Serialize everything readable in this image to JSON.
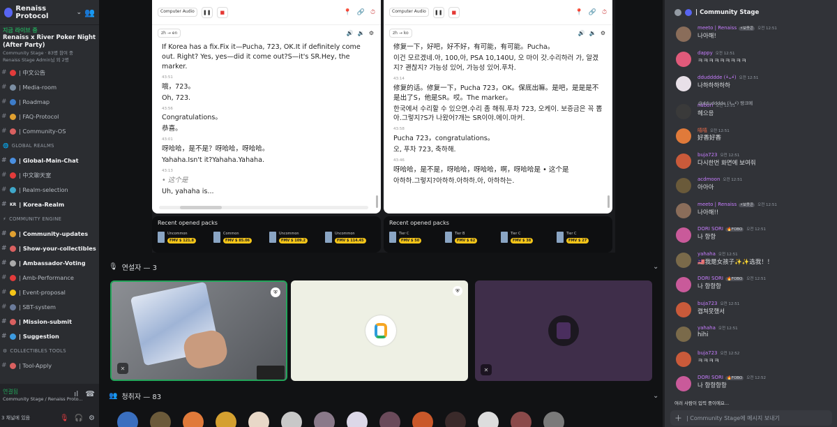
{
  "sidebar": {
    "server_name": "Renaiss Protocol",
    "live_tag": "지금 라이브 중",
    "event_title": "Renaiss x River Poker Night (After Party)",
    "stage_line": "Community Stage · 83명 참여 중",
    "admin_line": "Renaiss Stage Admin님 외 2명",
    "channels_top": [
      {
        "label": "| 中文公告",
        "color": "#e23b3b"
      },
      {
        "label": "| Media-room",
        "color": "#7b8ea3"
      },
      {
        "label": "| Roadmap",
        "color": "#3d7cc9"
      },
      {
        "label": "| FAQ-Protocol",
        "color": "#e0a030"
      },
      {
        "label": "| Community-OS",
        "color": "#d96060"
      }
    ],
    "cat_global": "GLOBAL REALMS",
    "channels_global": [
      {
        "label": "| Global-Main-Chat",
        "color": "#4a8fe0",
        "bold": true
      },
      {
        "label": "| 中文聊天室",
        "color": "#e23b3b"
      },
      {
        "label": "| Realm-selection",
        "color": "#3fa7c9"
      },
      {
        "label": "| Korea-Realm",
        "prefix": "KR",
        "bold": true
      }
    ],
    "cat_engine": "COMMUNITY ENGINE",
    "channels_engine": [
      {
        "label": "| Community-updates",
        "color": "#e0a030",
        "bold": true
      },
      {
        "label": "| Show-your-collectibles",
        "color": "#d96060",
        "bold": true
      },
      {
        "label": "| Ambassador-Voting",
        "color": "#aaa",
        "bold": true
      },
      {
        "label": "| Amb-Performance",
        "color": "#e23b3b"
      },
      {
        "label": "| Event-proposal",
        "color": "#f5c518"
      },
      {
        "label": "| SBT-system",
        "color": "#6b7b9b"
      },
      {
        "label": "| Mission-submit",
        "color": "#d96060",
        "bold": true
      },
      {
        "label": "| Suggestion",
        "color": "#3d9be0",
        "bold": true
      }
    ],
    "cat_tools": "COLLECTIBLES TOOLS",
    "channels_tools": [
      {
        "label": "| Tool-Apply",
        "color": "#d96060"
      }
    ],
    "voice_status": "연결됨",
    "voice_location": "Community Stage / Renaiss Proto...",
    "user_line": "3 채널에 있음"
  },
  "screenshare": {
    "left": {
      "source": "Computer Audio",
      "lang": "zh → en",
      "lines": [
        {
          "t": "",
          "text": "If Korea has a fix.Fix it—Pucha, 723, OK.It if definitely come out. Right? Yes, yes—did it come out?S—it's SR.Hey, the marker."
        },
        {
          "t": "43:51",
          "text": "哦，723。"
        },
        {
          "t": "",
          "text": "Oh, 723."
        },
        {
          "t": "43:56",
          "text": "Congratulations。"
        },
        {
          "t": "",
          "text": "恭喜。"
        },
        {
          "t": "43:01",
          "text": "呀哈哈，是不是？呀哈哈，呀哈哈。"
        },
        {
          "t": "",
          "text": "Yahaha.Isn't it?Yahaha.Yahaha."
        },
        {
          "t": "43:13",
          "text": "• 这个是",
          "pending": true
        },
        {
          "t": "",
          "text": "Uh, yahaha is..."
        }
      ],
      "packs_title": "Recent opened packs",
      "packs": [
        {
          "name": "Uncommon",
          "fmv": "FMV $ 121.8"
        },
        {
          "name": "Common",
          "fmv": "FMV $ 85.06"
        },
        {
          "name": "Uncommon",
          "fmv": "FMV $ 109.2"
        },
        {
          "name": "Uncommon",
          "fmv": "FMV $ 114.45"
        }
      ]
    },
    "right": {
      "source": "Computer Audio",
      "lang": "zh → ko",
      "lines": [
        {
          "t": "",
          "text": "修复一下，好吧，好不好，有可能，有可能。Pucha。"
        },
        {
          "t": "",
          "text": "이건 모르겠네.아, 100,아, PSA 10,140U, 오 마이 갓.수리하러 가, 알겠지? 괜찮지? 가능성 있어, 가능성 있어.푸차."
        },
        {
          "t": "43:14",
          "text": "修复的话。修复一下，Pucha 723，OK。保底出嘛。是吧，是是是不是出了S，他是SR。哎。The marker。"
        },
        {
          "t": "",
          "text": "한국에서 수리할 수 있으면.수리 좀 해줘.푸차 723, 오케이. 보증금은 꼭 뽑아.그렇지?S가 나왔어?개는 SR이야.에이.마커."
        },
        {
          "t": "43:58",
          "text": "Pucha 723，congratulations。"
        },
        {
          "t": "",
          "text": "오, 푸차 723, 축하해."
        },
        {
          "t": "43:46",
          "text": "呀哈哈，是不是，呀哈哈，呀哈哈，啊，呀哈哈是 • 这个是"
        },
        {
          "t": "",
          "text": "아하하.그렇지?아하하.아하하.아, 아하하는."
        }
      ],
      "packs_title": "Recent opened packs",
      "packs": [
        {
          "name": "Tier C",
          "fmv": "FMV $ 50"
        },
        {
          "name": "Tier B",
          "fmv": "FMV $ 62"
        },
        {
          "name": "Tier C",
          "fmv": "FMV $ 38"
        },
        {
          "name": "Tier C",
          "fmv": "FMV $ 27"
        }
      ]
    }
  },
  "stage": {
    "speakers_label": "연설자 — 3",
    "audience_label": "청취자 — 83"
  },
  "chat": {
    "header": "| Community Stage",
    "input_placeholder": "| Community Stage에 메시지 보내기",
    "typing": "여러 사람이 입력 중이에요...",
    "reply_preview": "@ddudddde (•̀ᴗ•́)  땅크메",
    "messages": [
      {
        "name": "meeto | Renaiss",
        "badge": "⚡보좃콘",
        "time": "오전 12:51",
        "body": "나아해!",
        "color": "#c77dff",
        "av": "#8a6d5a"
      },
      {
        "name": "dappy",
        "time": "오전 12:51",
        "body": "ㅋㅋㅋㅋㅋㅋㅋㅋㅋ",
        "color": "#c77dff",
        "av": "#e05a7a"
      },
      {
        "name": "ddudddde (•̀ᴗ•́)",
        "time": "오전 12:51",
        "body": "나하하하하하",
        "color": "#c77dff",
        "av": "#e8e0e8"
      },
      {
        "name": "nabori",
        "time": "오전 12:51",
        "body": "헤으응",
        "color": "#c77dff",
        "av": "#3a3a3a"
      },
      {
        "name": "嘻嘻",
        "time": "오전 12:51",
        "body": "好香好香",
        "color": "#e0684a",
        "av": "#e07a3a"
      },
      {
        "name": "buja723",
        "time": "오전 12:51",
        "body": "다시한번 화면에 보여줘",
        "color": "#c77dff",
        "av": "#c95a3a"
      },
      {
        "name": "acdmoon",
        "time": "오전 12:51",
        "body": "아아아",
        "color": "#c77dff",
        "av": "#6a5a3a"
      },
      {
        "name": "meeto | Renaiss",
        "badge": "⚡보좃콘",
        "time": "오전 12:51",
        "body": "나아해!!",
        "color": "#c77dff",
        "av": "#8a6d5a"
      },
      {
        "name": "DORI SORI",
        "badge": "🔥FOBO",
        "time": "오전 12:51",
        "body": "나 항항",
        "color": "#c77dff",
        "av": "#c95a9a"
      },
      {
        "name": "yahaha",
        "time": "오전 12:51",
        "body": "🇲🇾我是女孩子✨✨选我！！",
        "color": "#c77dff",
        "av": "#7a6a4a"
      },
      {
        "name": "DORI SORI",
        "badge": "🔥FOBO",
        "time": "오전 12:51",
        "body": "나 항항항",
        "color": "#c77dff",
        "av": "#c95a9a"
      },
      {
        "name": "buja723",
        "time": "오전 12:51",
        "body": "캡쳐못했서",
        "color": "#c77dff",
        "av": "#c95a3a"
      },
      {
        "name": "yahaha",
        "time": "오전 12:51",
        "body": "hihi",
        "color": "#c77dff",
        "av": "#7a6a4a"
      },
      {
        "name": "buja723",
        "time": "오전 12:52",
        "body": "ㅋㅋㅋㅋ",
        "color": "#c77dff",
        "av": "#c95a3a"
      },
      {
        "name": "DORI SORI",
        "badge": "🔥FOBO",
        "time": "오전 12:52",
        "body": "나 항항항항",
        "color": "#c77dff",
        "av": "#c95a9a"
      }
    ]
  },
  "colors": {
    "accent": "#5865f2",
    "online": "#23a55a",
    "bg_dark": "#1e1f22",
    "sidebar": "#2b2d31"
  },
  "audience_avatar_colors": [
    "#3a6fbf",
    "#6b5a3a",
    "#e07a3a",
    "#d4a030",
    "#e8d8c8",
    "#c8c8c8",
    "#8a7a8a",
    "#dcd8e8",
    "#6a4a5a",
    "#c9582a",
    "#3a2a2a",
    "#ddd",
    "#8a4a4a",
    "#7a7a7a"
  ]
}
